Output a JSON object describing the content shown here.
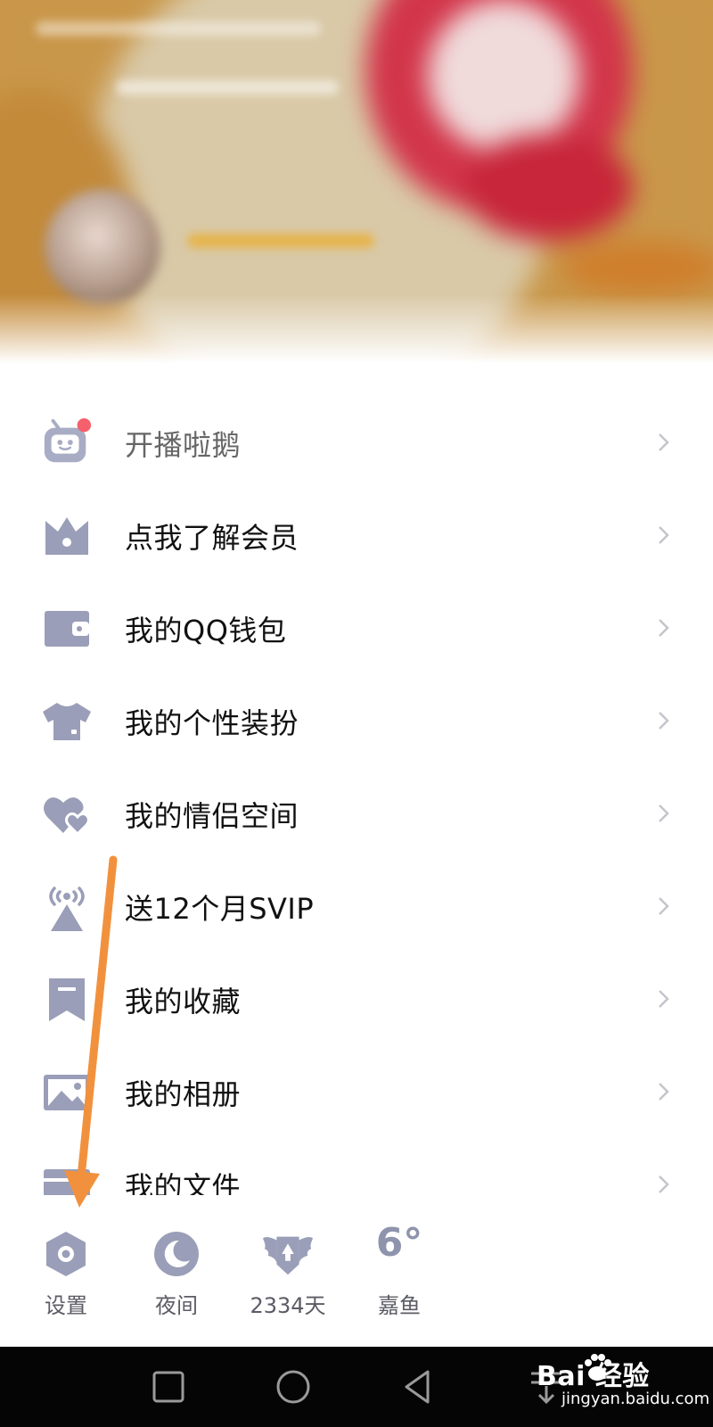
{
  "menu": {
    "items": [
      {
        "label": "开播啦鹅",
        "icon": "tv-mascot-icon"
      },
      {
        "label": "点我了解会员",
        "icon": "crown-icon"
      },
      {
        "label": "我的QQ钱包",
        "icon": "wallet-icon"
      },
      {
        "label": "我的个性装扮",
        "icon": "shirt-icon"
      },
      {
        "label": "我的情侣空间",
        "icon": "hearts-icon"
      },
      {
        "label": "送12个月SVIP",
        "icon": "broadcast-icon"
      },
      {
        "label": "我的收藏",
        "icon": "bookmark-icon"
      },
      {
        "label": "我的相册",
        "icon": "photo-icon"
      },
      {
        "label": "我的文件",
        "icon": "folder-icon"
      }
    ]
  },
  "bottom_bar": {
    "settings": {
      "label": "设置",
      "icon": "gear-hexagon-icon"
    },
    "night": {
      "label": "夜间",
      "icon": "moon-icon"
    },
    "days": {
      "label": "2334天",
      "icon": "winged-badge-icon"
    },
    "weather": {
      "label": "嘉鱼",
      "temperature": "6°"
    }
  },
  "watermark": {
    "main": "Bai 经验",
    "sub": "jingyan.baidu.com"
  },
  "colors": {
    "icon": "#9a9eb8",
    "badge": "#f4606c",
    "arrow": "#f2913d",
    "text": "#111111"
  }
}
